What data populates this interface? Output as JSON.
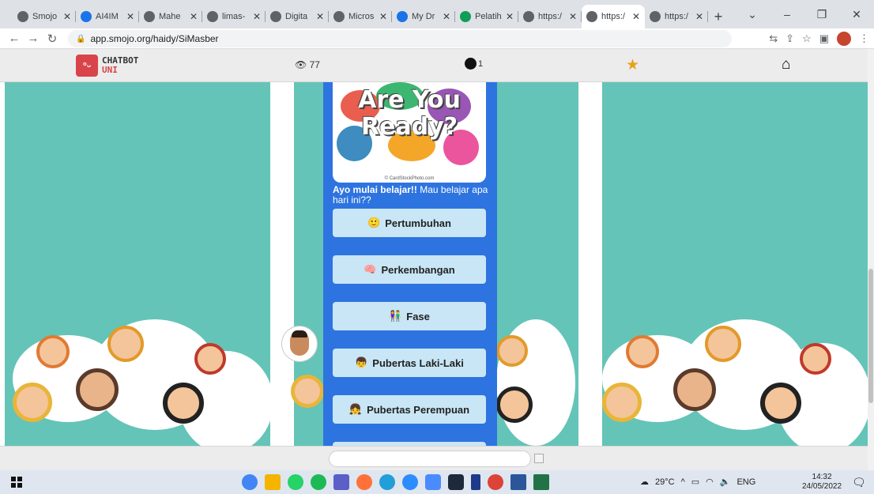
{
  "browser": {
    "tabs": [
      {
        "label": "Smojo",
        "color": "#5f6368",
        "active": false
      },
      {
        "label": "AI4IM",
        "color": "#1a73e8",
        "active": false
      },
      {
        "label": "Mahe",
        "color": "#5f6368",
        "active": false
      },
      {
        "label": "limas-",
        "color": "#5f6368",
        "active": false
      },
      {
        "label": "Digita",
        "color": "#5f6368",
        "active": false
      },
      {
        "label": "Micros",
        "color": "#5f6368",
        "active": false
      },
      {
        "label": "My Dr",
        "color": "#1a73e8",
        "active": false
      },
      {
        "label": "Pelatih",
        "color": "#0f9d58",
        "active": false
      },
      {
        "label": "https:/",
        "color": "#5f6368",
        "active": false
      },
      {
        "label": "https:/",
        "color": "#5f6368",
        "active": true
      },
      {
        "label": "https:/",
        "color": "#5f6368",
        "active": false
      }
    ],
    "url": "app.smojo.org/haidy/SiMasber"
  },
  "header": {
    "logo_line1": "CHATBOT",
    "logo_line2": "UNI",
    "views": "77",
    "comments": "1"
  },
  "hero": {
    "line1": "Are You",
    "line2": "Ready?",
    "caption": "© CardStockPhoto.com"
  },
  "bot_message": {
    "bold": "Ayo mulai belajar!!",
    "rest": " Mau belajar apa hari ini??"
  },
  "options": [
    {
      "emoji": "🙂",
      "label": "Pertumbuhan"
    },
    {
      "emoji": "🧠",
      "label": "Perkembangan"
    },
    {
      "emoji": "👫",
      "label": "Fase"
    },
    {
      "emoji": "👦",
      "label": "Pubertas Laki-Laki"
    },
    {
      "emoji": "👧",
      "label": "Pubertas Perempuan"
    }
  ],
  "input": {
    "placeholder": ""
  },
  "taskbar": {
    "weather": "29°C",
    "lang": "ENG",
    "time": "14:32",
    "date": "24/05/2022"
  },
  "colors": {
    "page_bg": "#64c4b7",
    "chat_column": "#2e74e0",
    "option_bg": "#c8e6f5",
    "logo_red": "#d9444a",
    "star": "#e8a21a"
  }
}
